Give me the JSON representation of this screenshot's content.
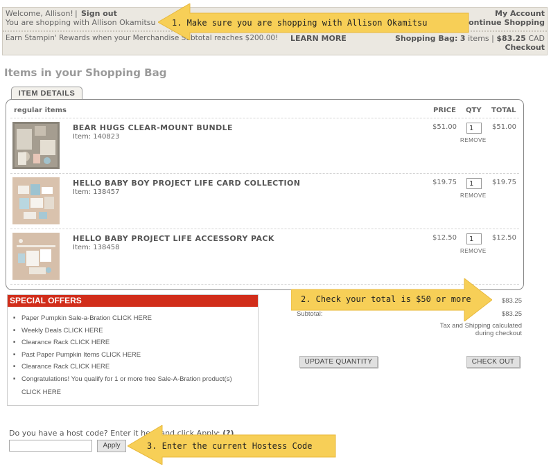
{
  "topbar": {
    "welcome": "Welcome, Allison!",
    "sep": "|",
    "sign_out": "Sign out",
    "shopping_with": "You are shopping with Allison Okamitsu",
    "my_account": "My Account",
    "continue_shopping": "Continue Shopping",
    "rewards_text": "Earn Stampin' Rewards when your Merchandise Subtotal reaches $200.00!",
    "learn_more": "LEARN MORE",
    "shopping_bag_label": "Shopping Bag:",
    "bag_count": "3",
    "items_word": "items |",
    "bag_total": "$83.25",
    "currency": "CAD",
    "checkout": "Checkout"
  },
  "page_title": "Items in your Shopping Bag",
  "tab_label": "ITEM DETAILS",
  "table": {
    "section_label": "regular items",
    "col_price": "PRICE",
    "col_qty": "QTY",
    "col_total": "TOTAL",
    "remove_label": "REMOVE",
    "rows": [
      {
        "name": "BEAR HUGS CLEAR-MOUNT BUNDLE",
        "item": "Item: 140823",
        "price": "$51.00",
        "qty": "1",
        "total": "$51.00"
      },
      {
        "name": "HELLO BABY BOY PROJECT LIFE CARD COLLECTION",
        "item": "Item: 138457",
        "price": "$19.75",
        "qty": "1",
        "total": "$19.75"
      },
      {
        "name": "HELLO BABY PROJECT LIFE ACCESSORY PACK",
        "item": "Item: 138458",
        "price": "$12.50",
        "qty": "1",
        "total": "$12.50"
      }
    ]
  },
  "offers": {
    "title": "SPECIAL OFFERS",
    "items": [
      "Paper Pumpkin Sale-a-Bration CLICK HERE",
      "Weekly Deals CLICK HERE",
      "Clearance Rack CLICK HERE",
      "Past Paper Pumpkin Items CLICK HERE",
      "Clearance Rack CLICK HERE",
      "Congratulations! You qualify for 1 or more free Sale-A-Bration product(s)",
      "CLICK HERE"
    ]
  },
  "summary": {
    "merch_total": "$83.25",
    "subtotal_label": "Subtotal:",
    "subtotal_value": "$83.25",
    "tax_note_1": "Tax and Shipping calculated",
    "tax_note_2": "during checkout",
    "update_quantity": "UPDATE QUANTITY",
    "check_out": "CHECK OUT"
  },
  "host": {
    "label": "Do you have a host code? Enter it here and click Apply:",
    "help": "(?)",
    "input_value": "",
    "apply": "Apply"
  },
  "callouts": {
    "c1": "1. Make sure you are shopping with Allison Okamitsu",
    "c2": "2. Check your total is $50 or more",
    "c3": "3. Enter the current Hostess Code"
  },
  "colors": {
    "callout_yellow": "#f7cf57",
    "offers_red": "#d12d1a",
    "topbar_bg": "#ebe8e1"
  }
}
